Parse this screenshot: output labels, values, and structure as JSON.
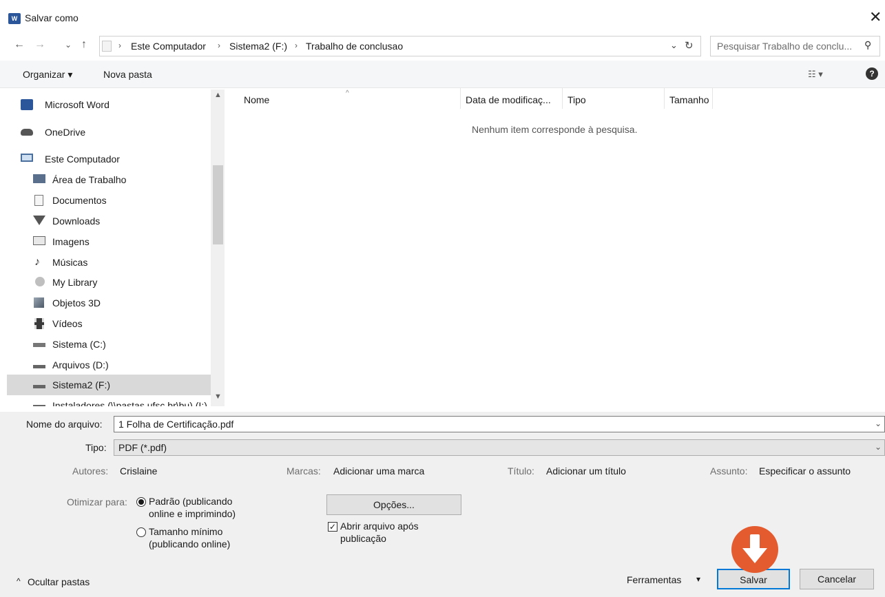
{
  "window": {
    "title": "Salvar como",
    "app_icon_text": "W",
    "close_glyph": "✕"
  },
  "nav": {
    "back_glyph": "←",
    "forward_glyph": "→",
    "recent_glyph": "⌄",
    "up_glyph": "↑"
  },
  "address": {
    "crumbs": [
      "Este Computador",
      "Sistema2 (F:)",
      "Trabalho de conclusao"
    ],
    "sep": "›",
    "dropdown_glyph": "⌄",
    "refresh_glyph": "↻"
  },
  "search": {
    "placeholder": "Pesquisar Trabalho de conclu...",
    "icon_glyph": "⚲"
  },
  "toolbar": {
    "organize": "Organizar ▾",
    "new_folder": "Nova pasta",
    "view_glyph": "☷ ▾",
    "help_glyph": "?"
  },
  "sidebar": {
    "items": [
      {
        "label": "Microsoft Word",
        "icon": "word-icon"
      },
      {
        "label": "OneDrive",
        "icon": "cloud-icon"
      },
      {
        "label": "Este Computador",
        "icon": "computer-icon"
      },
      {
        "label": "Área de Trabalho",
        "icon": "desktop-icon"
      },
      {
        "label": "Documentos",
        "icon": "document-icon"
      },
      {
        "label": "Downloads",
        "icon": "download-icon"
      },
      {
        "label": "Imagens",
        "icon": "pictures-icon"
      },
      {
        "label": "Músicas",
        "icon": "music-icon"
      },
      {
        "label": "My Library",
        "icon": "library-icon"
      },
      {
        "label": "Objetos 3D",
        "icon": "cube-icon"
      },
      {
        "label": "Vídeos",
        "icon": "video-icon"
      },
      {
        "label": "Sistema (C:)",
        "icon": "drive-icon"
      },
      {
        "label": "Arquivos (D:)",
        "icon": "drive-icon"
      },
      {
        "label": "Sistema2 (F:)",
        "icon": "drive-icon",
        "selected": true
      },
      {
        "label": "Instaladores (\\\\pastas.ufsc.br\\bu) (I:)",
        "icon": "network-drive-icon"
      }
    ],
    "scroll_up": "▲",
    "scroll_down": "▼"
  },
  "file_list": {
    "columns": [
      "Nome",
      "Data de modificaç...",
      "Tipo",
      "Tamanho"
    ],
    "sort_glyph": "^",
    "empty_message": "Nenhum item corresponde à pesquisa."
  },
  "form": {
    "filename_label": "Nome do arquivo:",
    "filename_value": "1 Folha de Certificação.pdf",
    "type_label": "Tipo:",
    "type_value": "PDF (*.pdf)",
    "chevron": "⌄",
    "authors_label": "Autores:",
    "authors_value": "Crislaine",
    "tags_label": "Marcas:",
    "tags_value": "Adicionar uma marca",
    "title_label": "Título:",
    "title_value": "Adicionar um título",
    "subject_label": "Assunto:",
    "subject_value": "Especificar o assunto",
    "optimize_label": "Otimizar para:",
    "optimize_options": [
      {
        "line1": "Padrão (publicando",
        "line2": "online e imprimindo)",
        "checked": true
      },
      {
        "line1": "Tamanho mínimo",
        "line2": "(publicando online)",
        "checked": false
      }
    ],
    "options_button": "Opções...",
    "open_after_line1": "Abrir arquivo após",
    "open_after_line2": "publicação",
    "open_after_checked": true
  },
  "footer": {
    "hide_folders": "Ocultar pastas",
    "hide_glyph": "^",
    "tools": "Ferramentas",
    "tools_glyph": "▾",
    "save": "Salvar",
    "cancel": "Cancelar"
  },
  "colors": {
    "accent": "#0078d7",
    "badge": "#e35b2f",
    "word": "#2b579a"
  }
}
